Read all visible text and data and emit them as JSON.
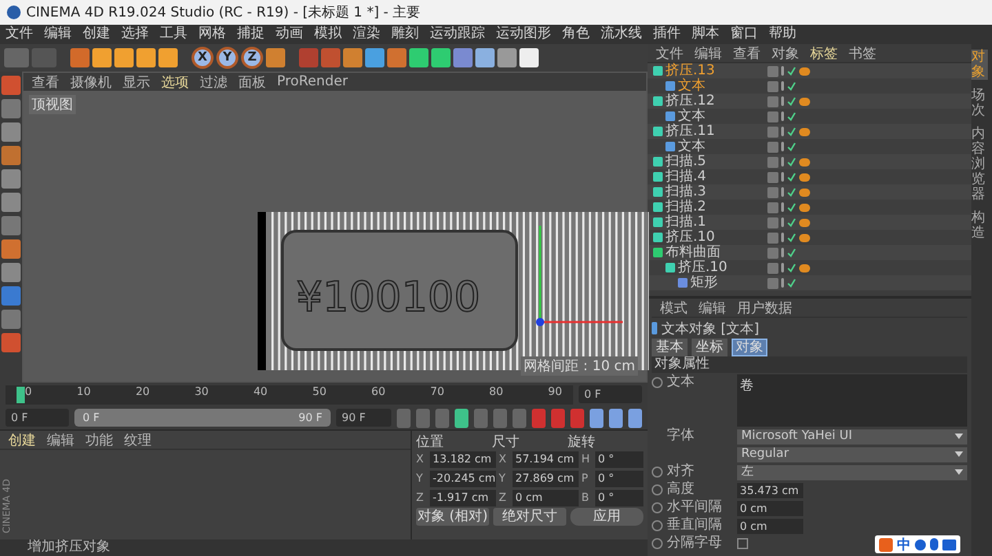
{
  "window": {
    "title": "CINEMA 4D R19.024 Studio (RC - R19) - [未标题 1 *] - 主要"
  },
  "menu": [
    "文件",
    "编辑",
    "创建",
    "选择",
    "工具",
    "网格",
    "捕捉",
    "动画",
    "模拟",
    "渲染",
    "雕刻",
    "运动跟踪",
    "运动图形",
    "角色",
    "流水线",
    "插件",
    "脚本",
    "窗口",
    "帮助"
  ],
  "toolbar": {
    "axes": [
      "X",
      "Y",
      "Z"
    ]
  },
  "viewport": {
    "menu": [
      "查看",
      "摄像机",
      "显示",
      "选项",
      "过滤",
      "面板",
      "ProRender"
    ],
    "label": "顶视图",
    "model_text": "¥100100",
    "grid_label": "网格间距 : 10 cm"
  },
  "object_manager": {
    "tabs": [
      "文件",
      "编辑",
      "查看",
      "对象",
      "标签",
      "书签"
    ],
    "objects": [
      {
        "name": "挤压.13",
        "kind": "extrude",
        "selected": true,
        "children": [
          {
            "name": "文本",
            "kind": "text",
            "selected": true
          }
        ]
      },
      {
        "name": "挤压.12",
        "kind": "extrude",
        "selected": false,
        "children": [
          {
            "name": "文本",
            "kind": "text",
            "selected": false
          }
        ]
      },
      {
        "name": "挤压.11",
        "kind": "extrude",
        "selected": false,
        "children": [
          {
            "name": "文本",
            "kind": "text",
            "selected": false
          }
        ]
      },
      {
        "name": "扫描.5",
        "kind": "sweep",
        "selected": false
      },
      {
        "name": "扫描.4",
        "kind": "sweep",
        "selected": false
      },
      {
        "name": "扫描.3",
        "kind": "sweep",
        "selected": false
      },
      {
        "name": "扫描.2",
        "kind": "sweep",
        "selected": false
      },
      {
        "name": "扫描.1",
        "kind": "sweep",
        "selected": false
      },
      {
        "name": "挤压.10",
        "kind": "extrude",
        "selected": false
      },
      {
        "name": "布料曲面",
        "kind": "cloth",
        "selected": false,
        "children": [
          {
            "name": "挤压.10",
            "kind": "extrude",
            "selected": false,
            "children": [
              {
                "name": "矩形",
                "kind": "spline",
                "selected": false
              }
            ]
          }
        ]
      }
    ]
  },
  "side_tabs": [
    {
      "label": "对象",
      "selected": true
    },
    {
      "label": "场次",
      "selected": false
    },
    {
      "label": "内容浏览器",
      "selected": false
    },
    {
      "label": "构造",
      "selected": false
    }
  ],
  "attributes": {
    "menu": [
      "模式",
      "编辑",
      "用户数据"
    ],
    "title": "文本对象 [文本]",
    "tabs": [
      {
        "label": "基本",
        "selected": false
      },
      {
        "label": "坐标",
        "selected": false
      },
      {
        "label": "对象",
        "selected": true
      }
    ],
    "section": "对象属性",
    "text_label": "文本",
    "text_keyframe": false,
    "text_value": "卷",
    "fields": [
      {
        "kind": "dropdown",
        "label": "字体",
        "value": "Microsoft YaHei UI"
      },
      {
        "kind": "dropdown",
        "value": "Regular"
      },
      {
        "kind": "dropdown",
        "label": "对齐",
        "keyframe": false,
        "value": "左"
      },
      {
        "kind": "number",
        "label": "高度",
        "keyframe": false,
        "value": "35.473 cm"
      },
      {
        "kind": "number",
        "label": "水平间隔",
        "keyframe": false,
        "value": "0 cm"
      },
      {
        "kind": "number",
        "label": "垂直间隔",
        "keyframe": false,
        "value": "0 cm"
      },
      {
        "kind": "checkbox",
        "label": "分隔字母",
        "keyframe": false,
        "checked": false
      }
    ]
  },
  "timeline": {
    "ticks": [
      "0",
      "10",
      "20",
      "30",
      "40",
      "50",
      "60",
      "70",
      "80",
      "90"
    ],
    "level": 0,
    "current": "0 F",
    "start": "0 F",
    "range": {
      "start": "0 F",
      "end": "90 F",
      "level": 1
    },
    "end": "90 F"
  },
  "materials": {
    "tabs": [
      "创建",
      "编辑",
      "功能",
      "纹理"
    ],
    "brand": "CINEMA 4D"
  },
  "coordinates": {
    "headers": [
      "位置",
      "尺寸",
      "旋转"
    ],
    "rows": [
      {
        "a1": "X",
        "v1": "13.182 cm",
        "a2": "X",
        "v2": "57.194 cm",
        "a3": "H",
        "v3": "0 °"
      },
      {
        "a1": "Y",
        "v1": "-20.245 cm",
        "a2": "Y",
        "v2": "27.869 cm",
        "a3": "P",
        "v3": "0 °"
      },
      {
        "a1": "Z",
        "v1": "-1.917 cm",
        "a2": "Z",
        "v2": "0 cm",
        "a3": "B",
        "v3": "0 °"
      }
    ],
    "mode": "对象 (相对)",
    "size_mode": "绝对尺寸",
    "apply": "应用"
  },
  "status": "增加挤压对象",
  "ime": {
    "label": "中"
  }
}
